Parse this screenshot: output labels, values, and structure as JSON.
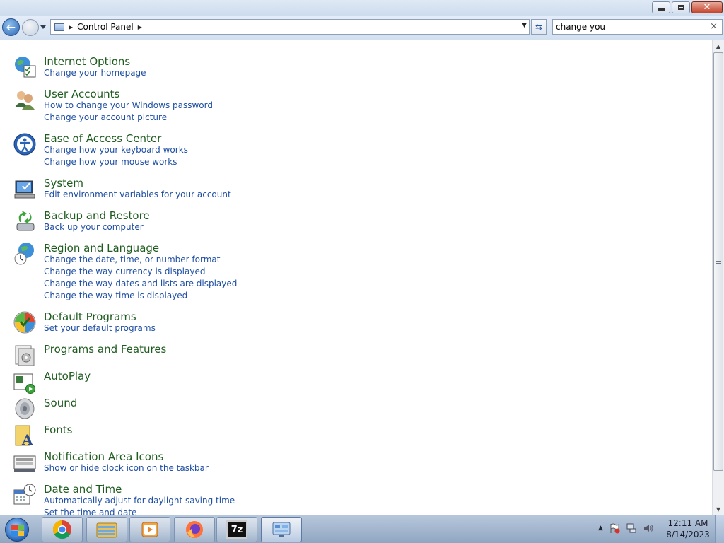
{
  "window": {
    "buttons": {
      "minimize": "minimize",
      "maximize": "restore",
      "close": "close"
    }
  },
  "navbar": {
    "back_label": "back",
    "address": {
      "crumb": "Control Panel"
    },
    "search": {
      "value": "change you"
    }
  },
  "items": [
    {
      "title": "Internet Options",
      "icon": "internet-options-icon",
      "links": [
        "Change your homepage"
      ]
    },
    {
      "title": "User Accounts",
      "icon": "user-accounts-icon",
      "links": [
        "How to change your Windows password",
        "Change your account picture"
      ]
    },
    {
      "title": "Ease of Access Center",
      "icon": "ease-of-access-icon",
      "links": [
        "Change how your keyboard works",
        "Change how your mouse works"
      ]
    },
    {
      "title": "System",
      "icon": "system-icon",
      "links": [
        "Edit environment variables for your account"
      ]
    },
    {
      "title": "Backup and Restore",
      "icon": "backup-restore-icon",
      "links": [
        "Back up your computer"
      ]
    },
    {
      "title": "Region and Language",
      "icon": "region-language-icon",
      "links": [
        "Change the date, time, or number format",
        "Change the way currency is displayed",
        "Change the way dates and lists are displayed",
        "Change the way time is displayed"
      ]
    },
    {
      "title": "Default Programs",
      "icon": "default-programs-icon",
      "links": [
        "Set your default programs"
      ]
    },
    {
      "title": "Programs and Features",
      "icon": "programs-features-icon",
      "links": []
    },
    {
      "title": "AutoPlay",
      "icon": "autoplay-icon",
      "links": []
    },
    {
      "title": "Sound",
      "icon": "sound-icon",
      "links": []
    },
    {
      "title": "Fonts",
      "icon": "fonts-icon",
      "links": []
    },
    {
      "title": "Notification Area Icons",
      "icon": "notification-area-icon",
      "links": [
        "Show or hide clock icon on the taskbar"
      ]
    },
    {
      "title": "Date and Time",
      "icon": "date-time-icon",
      "links": [
        "Automatically adjust for daylight saving time",
        "Set the time and date"
      ]
    }
  ],
  "taskbar": {
    "apps": [
      {
        "name": "chrome-icon"
      },
      {
        "name": "file-explorer-icon"
      },
      {
        "name": "media-player-icon"
      },
      {
        "name": "firefox-icon"
      },
      {
        "name": "7zip-icon",
        "label": "7z"
      },
      {
        "name": "control-panel-icon"
      }
    ],
    "clock": {
      "time": "12:11 AM",
      "date": "8/14/2023"
    }
  },
  "colors": {
    "title_green": "#1e5b1e",
    "link_blue": "#1f4fa3",
    "taskbar": "#9fb4cf"
  }
}
